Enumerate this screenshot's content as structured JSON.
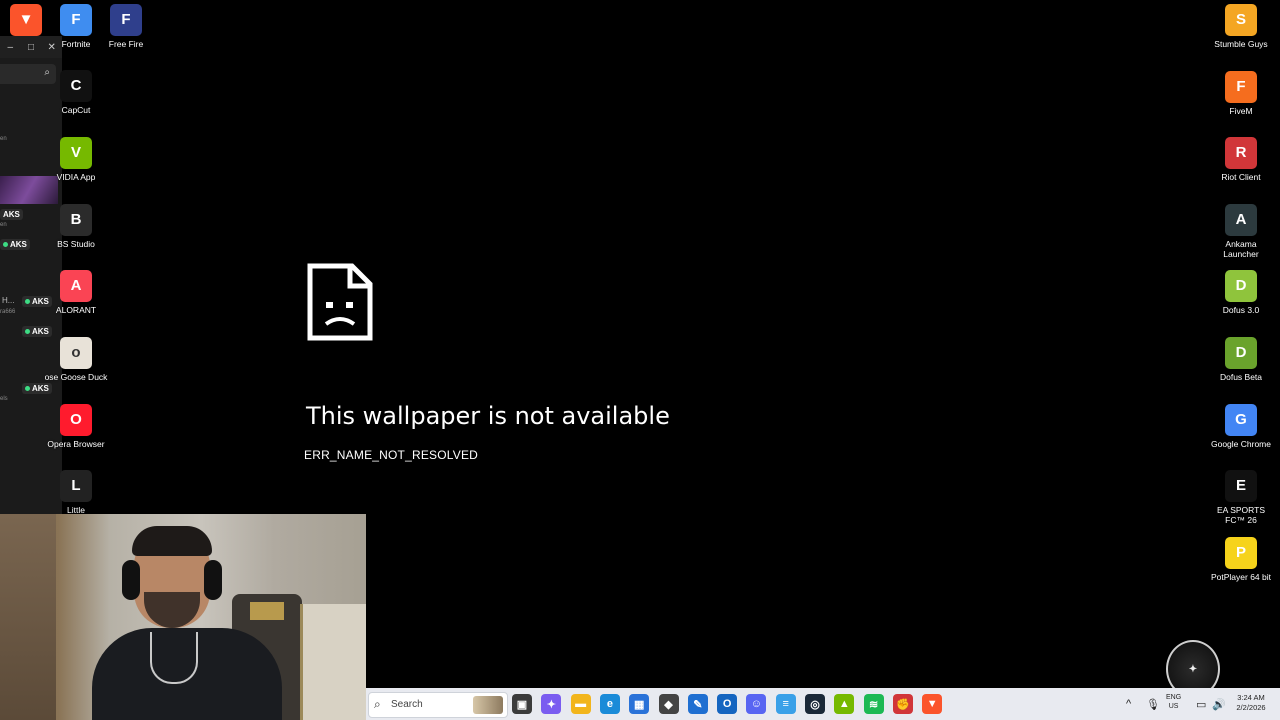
{
  "error": {
    "title": "This wallpaper is not available",
    "code": "ERR_NAME_NOT_RESOLVED"
  },
  "desktop_icons_left": [
    {
      "label": "Fortnite",
      "icon": "fortnite-icon",
      "color": "#3f8df0"
    },
    {
      "label": "Free Fire",
      "icon": "free-fire-icon",
      "color": "#2f3f8c"
    },
    {
      "label": "CapCut",
      "icon": "capcut-icon",
      "color": "#111111"
    },
    {
      "label": "VIDIA App",
      "icon": "nvidia-icon",
      "color": "#76b900"
    },
    {
      "label": "BS Studio",
      "icon": "obs-studio-icon",
      "color": "#2b2b2b"
    },
    {
      "label": "ALORANT",
      "icon": "valorant-icon",
      "color": "#fa4454"
    },
    {
      "label": "ose Goose Duck",
      "icon": "goose-goose-duck-icon",
      "color": "#e8e2d8"
    },
    {
      "label": "Opera Browser",
      "icon": "opera-icon",
      "color": "#ff1b2d"
    },
    {
      "label": "Little",
      "icon": "little-nightmares-icon",
      "color": "#222222"
    }
  ],
  "desktop_icons_right": [
    {
      "label": "Stumble Guys",
      "icon": "stumble-guys-icon",
      "color": "#f4a623"
    },
    {
      "label": "FiveM",
      "icon": "fivem-icon",
      "color": "#f56d1e"
    },
    {
      "label": "Riot Client",
      "icon": "riot-client-icon",
      "color": "#d13639"
    },
    {
      "label": "Ankama Launcher",
      "icon": "ankama-launcher-icon",
      "color": "#2c3a3e"
    },
    {
      "label": "Dofus 3.0",
      "icon": "dofus-icon",
      "color": "#8fc43c"
    },
    {
      "label": "Dofus Beta",
      "icon": "dofus-beta-icon",
      "color": "#6aa32c"
    },
    {
      "label": "Google Chrome",
      "icon": "chrome-icon",
      "color": "#4285f4"
    },
    {
      "label": "EA SPORTS FC™ 26",
      "icon": "ea-sports-fc-icon",
      "color": "#111111"
    },
    {
      "label": "PotPlayer 64 bit",
      "icon": "potplayer-icon",
      "color": "#f6d31b"
    }
  ],
  "top_left_icon": {
    "icon": "brave-icon",
    "color": "#fb542b"
  },
  "left_panel": {
    "badge": "AKS",
    "frag_h": "H...",
    "frag_user": "ra666",
    "frag_en": "en",
    "frag_els": "els"
  },
  "taskbar": {
    "search_placeholder": "Search",
    "apps": [
      {
        "icon": "task-view-icon",
        "color": "#3b3b3b",
        "glyph": "▣"
      },
      {
        "icon": "copilot-icon",
        "color": "#7a5cf0",
        "glyph": "✦"
      },
      {
        "icon": "file-explorer-icon",
        "color": "#f2b51c",
        "glyph": "▬"
      },
      {
        "icon": "edge-icon",
        "color": "#1a8bd8",
        "glyph": "e"
      },
      {
        "icon": "microsoft-store-icon",
        "color": "#2a72d8",
        "glyph": "▦"
      },
      {
        "icon": "app-cube-icon",
        "color": "#444444",
        "glyph": "◆"
      },
      {
        "icon": "visual-studio-code-icon",
        "color": "#1f6fd1",
        "glyph": "✎"
      },
      {
        "icon": "outlook-icon",
        "color": "#1565c0",
        "glyph": "O"
      },
      {
        "icon": "discord-icon",
        "color": "#5865f2",
        "glyph": "☺"
      },
      {
        "icon": "notepad-icon",
        "color": "#3aa0e8",
        "glyph": "≡"
      },
      {
        "icon": "steam-icon",
        "color": "#1b2838",
        "glyph": "◎"
      },
      {
        "icon": "nvidia-taskbar-icon",
        "color": "#76b900",
        "glyph": "▲"
      },
      {
        "icon": "spotify-icon",
        "color": "#1db954",
        "glyph": "≋"
      },
      {
        "icon": "riot-taskbar-icon",
        "color": "#d13639",
        "glyph": "✊"
      },
      {
        "icon": "brave-taskbar-icon",
        "color": "#fb542b",
        "glyph": "▼"
      }
    ],
    "lang_line1": "ENG",
    "lang_line2": "US",
    "time": "3:24 AM",
    "date": "2/2/2026"
  }
}
